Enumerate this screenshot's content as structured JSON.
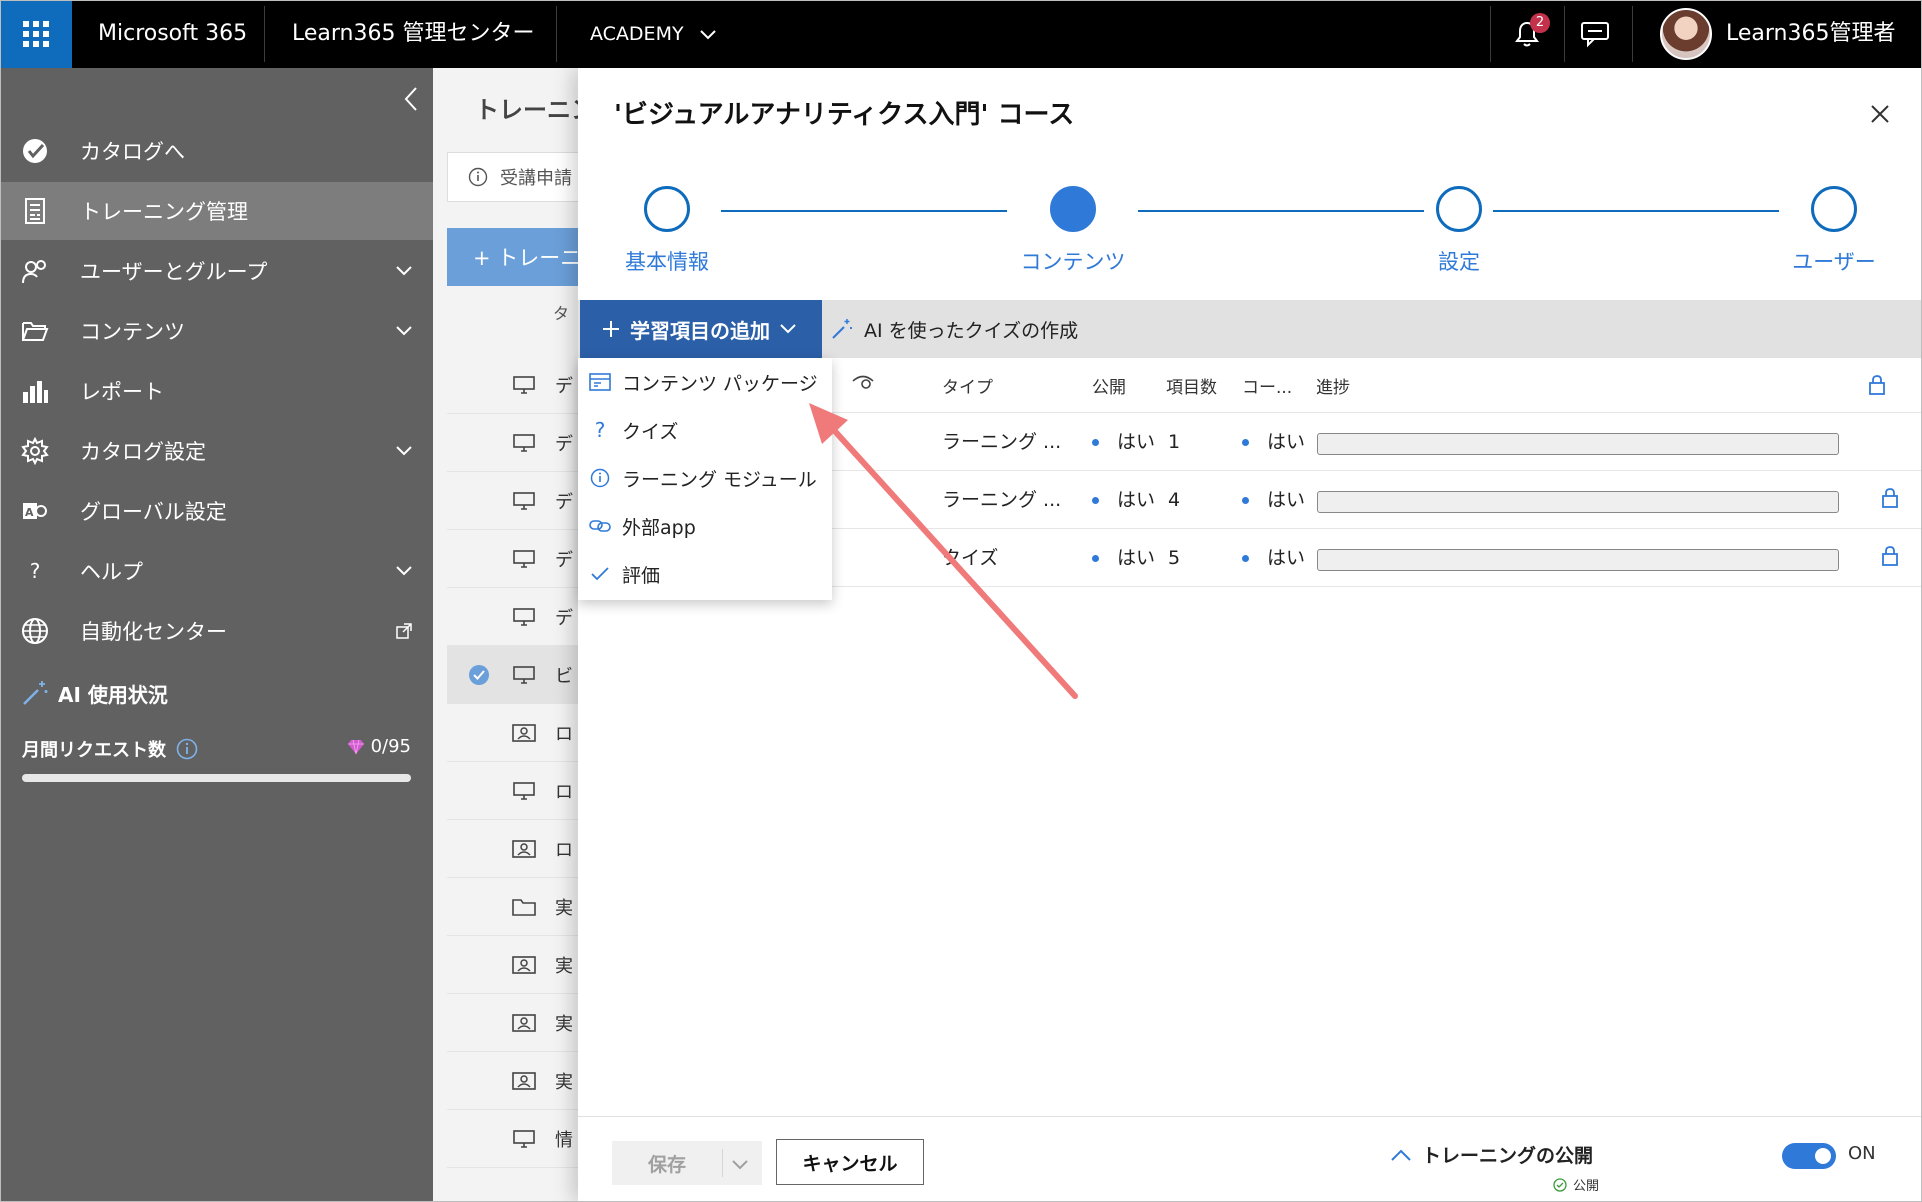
{
  "topbar": {
    "app_name": "Microsoft 365",
    "center_name": "Learn365 管理センター",
    "tenant": "ACADEMY",
    "notification_count": "2",
    "user_name": "Learn365管理者"
  },
  "nav": {
    "items": [
      {
        "label": "カタログへ",
        "icon": "catalog-check-icon"
      },
      {
        "label": "トレーニング管理",
        "icon": "training-doc-icon",
        "active": true
      },
      {
        "label": "ユーザーとグループ",
        "icon": "users-icon",
        "expandable": true
      },
      {
        "label": "コンテンツ",
        "icon": "folder-icon",
        "expandable": true
      },
      {
        "label": "レポート",
        "icon": "bar-chart-icon"
      },
      {
        "label": "カタログ設定",
        "icon": "gear-icon",
        "expandable": true
      },
      {
        "label": "グローバル設定",
        "icon": "global-settings-icon"
      },
      {
        "label": "ヘルプ",
        "icon": "question-icon",
        "expandable": true
      },
      {
        "label": "自動化センター",
        "icon": "globe-icon",
        "external": true
      }
    ],
    "ai": {
      "title": "AI 使用状況",
      "requests_label": "月間リクエスト数",
      "requests_value": "0/95"
    }
  },
  "background": {
    "title": "トレーニン",
    "info": "受講申請",
    "add_button": "+ トレーニ",
    "column_head": "タ",
    "rows": [
      {
        "icon": "monitor-icon",
        "text": "デ"
      },
      {
        "icon": "monitor-icon",
        "text": "デ"
      },
      {
        "icon": "monitor-icon",
        "text": "デ"
      },
      {
        "icon": "monitor-icon",
        "text": "デ"
      },
      {
        "icon": "monitor-icon",
        "text": "デ"
      },
      {
        "icon": "monitor-icon",
        "text": "ビ",
        "selected": true
      },
      {
        "icon": "presenter-icon",
        "text": "ロ"
      },
      {
        "icon": "monitor-icon",
        "text": "ロ"
      },
      {
        "icon": "presenter-icon",
        "text": "ロ"
      },
      {
        "icon": "folder-icon",
        "text": "実"
      },
      {
        "icon": "presenter-icon",
        "text": "実"
      },
      {
        "icon": "presenter-icon",
        "text": "実"
      },
      {
        "icon": "presenter-icon",
        "text": "実"
      },
      {
        "icon": "monitor-icon",
        "text": "情"
      }
    ]
  },
  "panel": {
    "title": "'ビジュアルアナリティクス入門' コース",
    "steps": [
      {
        "label": "基本情報",
        "state": "done"
      },
      {
        "label": "コンテンツ",
        "state": "current"
      },
      {
        "label": "設定",
        "state": "todo"
      },
      {
        "label": "ユーザー",
        "state": "todo"
      }
    ],
    "toolbar": {
      "add_label": "学習項目の追加",
      "ai_quiz_label": "AI を使ったクイズの作成"
    },
    "table": {
      "headers": {
        "type": "タイプ",
        "published": "公開",
        "count": "項目数",
        "course": "コー...",
        "progress": "進捗"
      },
      "rows": [
        {
          "type": "ラーニング ...",
          "published": "はい",
          "count": "1",
          "course": "はい",
          "locked": false
        },
        {
          "type": "ラーニング ...",
          "published": "はい",
          "count": "4",
          "course": "はい",
          "locked": true
        },
        {
          "type": "クイズ",
          "published": "はい",
          "count": "5",
          "course": "はい",
          "locked": true
        }
      ]
    },
    "menu": [
      {
        "label": "コンテンツ パッケージ",
        "icon": "package-icon"
      },
      {
        "label": "クイズ",
        "icon": "question-icon"
      },
      {
        "label": "ラーニング モジュール",
        "icon": "info-icon"
      },
      {
        "label": "外部app",
        "icon": "link-icon"
      },
      {
        "label": "評価",
        "icon": "checkmark-icon"
      }
    ],
    "footer": {
      "save_label": "保存",
      "cancel_label": "キャンセル",
      "publish_label": "トレーニングの公開",
      "publish_status": "公開",
      "toggle_label": "ON"
    }
  },
  "colors": {
    "accent": "#2f7ad8",
    "dark_accent": "#2b5fa8",
    "nav_bg": "#616161",
    "arrow": "#f07a7a"
  }
}
